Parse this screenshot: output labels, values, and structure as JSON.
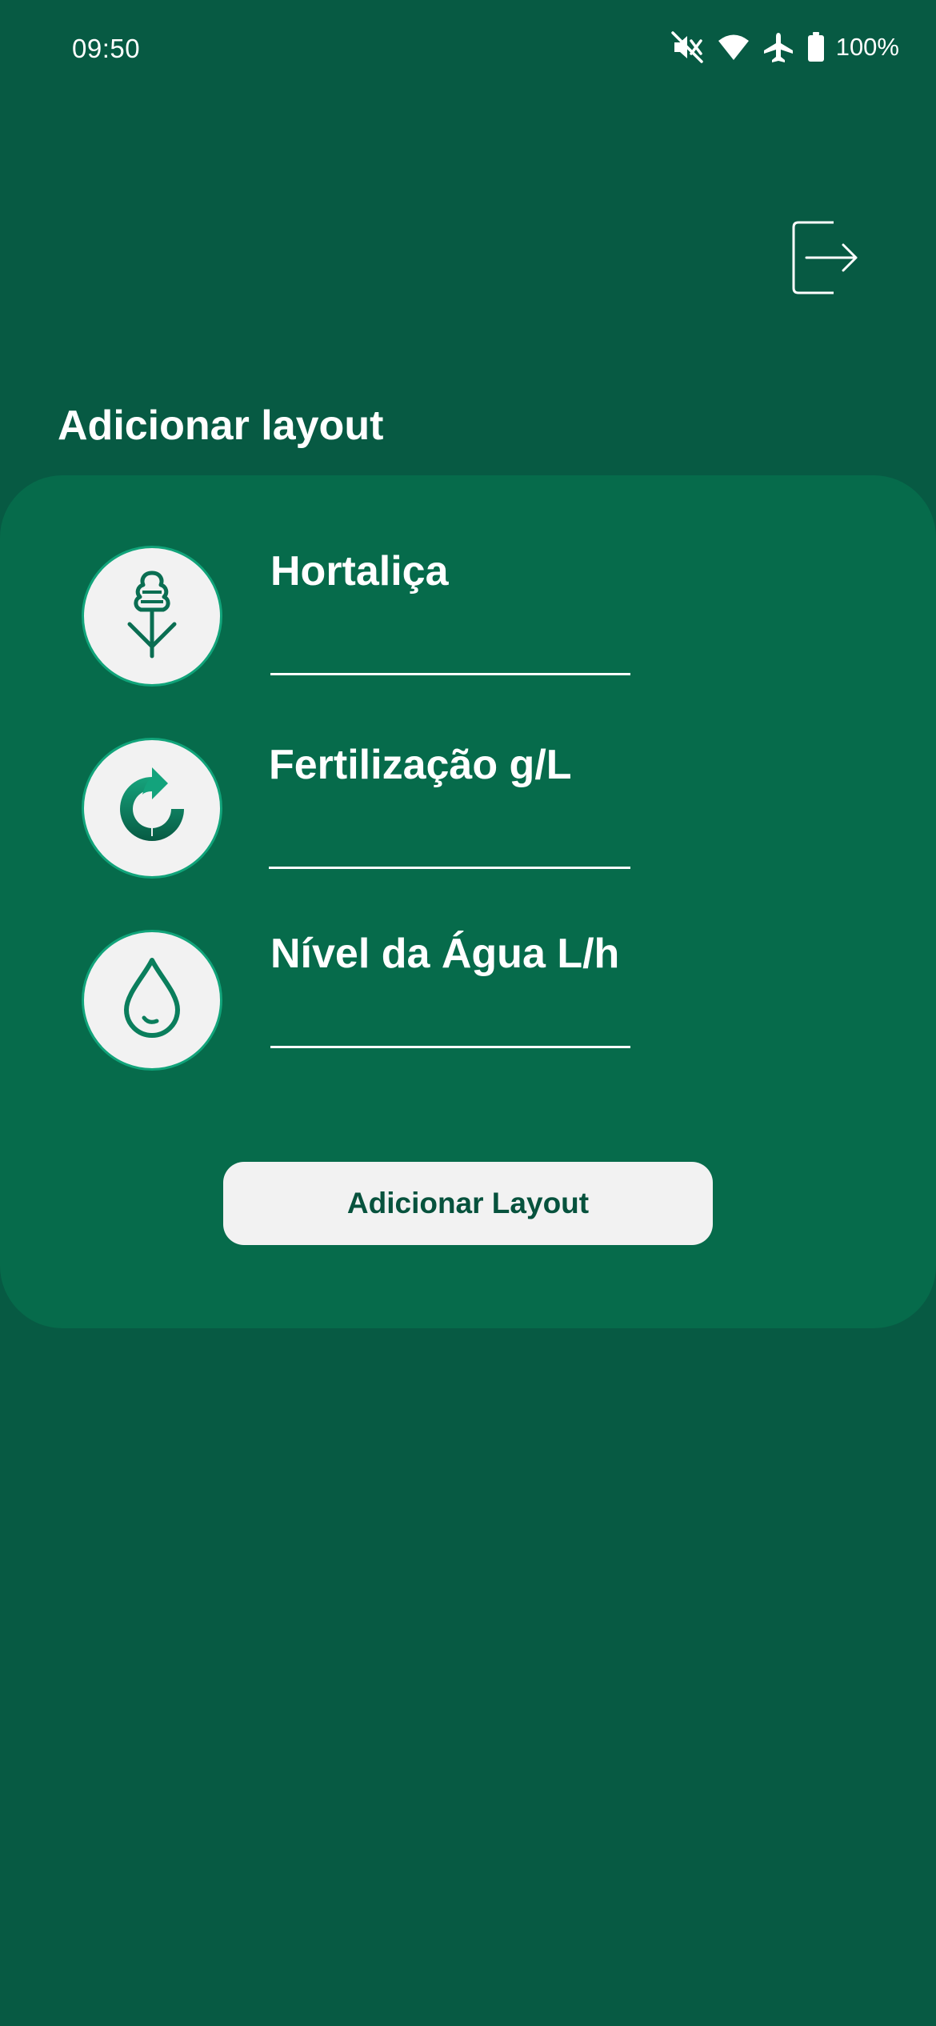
{
  "status_bar": {
    "time": "09:50",
    "battery": "100%",
    "icons": [
      "mute-icon",
      "wifi-icon",
      "airplane-mode-icon",
      "battery-icon"
    ]
  },
  "header": {
    "logout_icon": "logout-icon"
  },
  "page": {
    "title": "Adicionar layout"
  },
  "form": {
    "fields": [
      {
        "label": "Hortaliça",
        "icon": "plant-icon",
        "value": ""
      },
      {
        "label": "Fertilização g/L",
        "icon": "fertilizer-icon",
        "value": ""
      },
      {
        "label": "Nível da Água L/h",
        "icon": "water-drop-icon",
        "value": ""
      }
    ],
    "submit_label": "Adicionar Layout"
  },
  "colors": {
    "background": "#075a43",
    "card": "#066b4b",
    "accent": "#11a47a",
    "button": "#f2f2f2",
    "button_text": "#07523d"
  }
}
